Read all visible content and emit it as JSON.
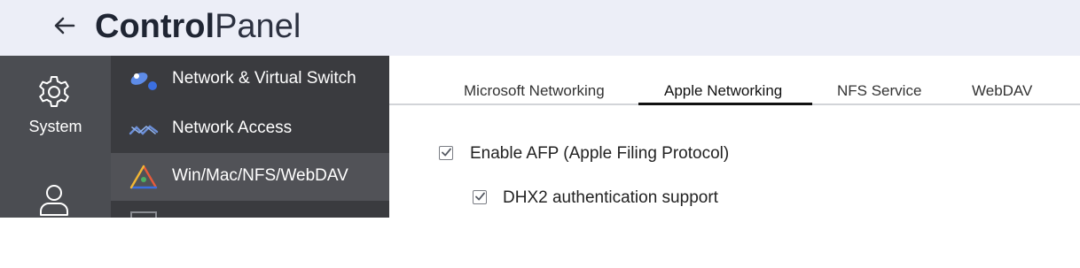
{
  "header": {
    "title_bold": "Control",
    "title_light": "Panel",
    "background_color": "#eceef7"
  },
  "rail": {
    "items": [
      {
        "label": "System",
        "icon": "gear-icon"
      },
      {
        "label": "",
        "icon": "user-icon"
      }
    ]
  },
  "menu": {
    "items": [
      {
        "label": "Network & Virtual Switch",
        "icon": "network-virtual-switch-icon",
        "active": false
      },
      {
        "label": "Network Access",
        "icon": "network-access-icon",
        "active": false
      },
      {
        "label": "Win/Mac/NFS/WebDAV",
        "icon": "win-mac-nfs-icon",
        "active": true
      }
    ]
  },
  "tabs": [
    {
      "label": "Microsoft Networking",
      "active": false
    },
    {
      "label": "Apple Networking",
      "active": true
    },
    {
      "label": "NFS Service",
      "active": false
    },
    {
      "label": "WebDAV",
      "active": false
    }
  ],
  "settings": {
    "enable_afp": {
      "label": "Enable AFP (Apple Filing Protocol)",
      "checked": true
    },
    "dhx2": {
      "label": "DHX2 authentication support",
      "checked": true
    }
  },
  "colors": {
    "rail": "#4b4d52",
    "menu": "#3a3b3f",
    "menu_active": "#515257",
    "accent_blue": "#2f5bd6"
  }
}
